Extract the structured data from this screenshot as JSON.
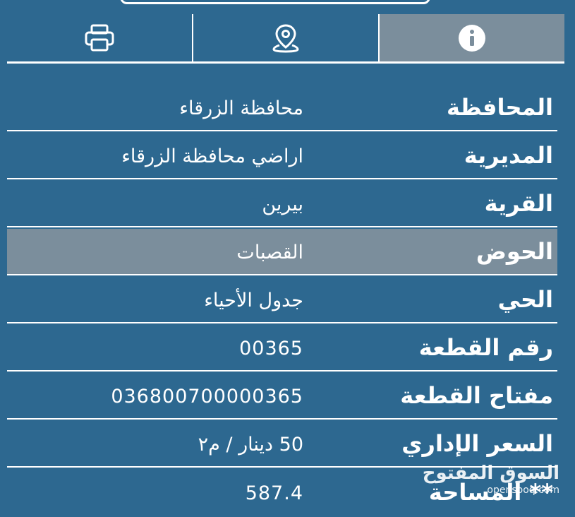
{
  "toolbar": {
    "tabs": [
      {
        "icon": "print-icon"
      },
      {
        "icon": "location-pin-icon"
      },
      {
        "icon": "info-icon",
        "active": true
      }
    ]
  },
  "details": {
    "rows": [
      {
        "label": "المحافظة",
        "value": "محافظة الزرقاء"
      },
      {
        "label": "المديرية",
        "value": "اراضي محافظة الزرقاء"
      },
      {
        "label": "القرية",
        "value": "بيرين"
      },
      {
        "label": "الحوض",
        "value": "القصبات",
        "highlighted": true
      },
      {
        "label": "الحي",
        "value": "جدول الأحياء"
      },
      {
        "label": "رقم القطعة",
        "value": "00365"
      },
      {
        "label": "مفتاح القطعة",
        "value": "036800700000365"
      },
      {
        "label": "السعر الإداري",
        "value": "50 دينار / م٢"
      },
      {
        "label": "** المساحة",
        "value": "587.4"
      }
    ]
  },
  "watermark": {
    "arabic": "السوق المفتوح",
    "latin": "opensooq.com"
  },
  "colors": {
    "background": "#2d6890",
    "highlight": "#7b8e9c",
    "text": "#ffffff"
  }
}
